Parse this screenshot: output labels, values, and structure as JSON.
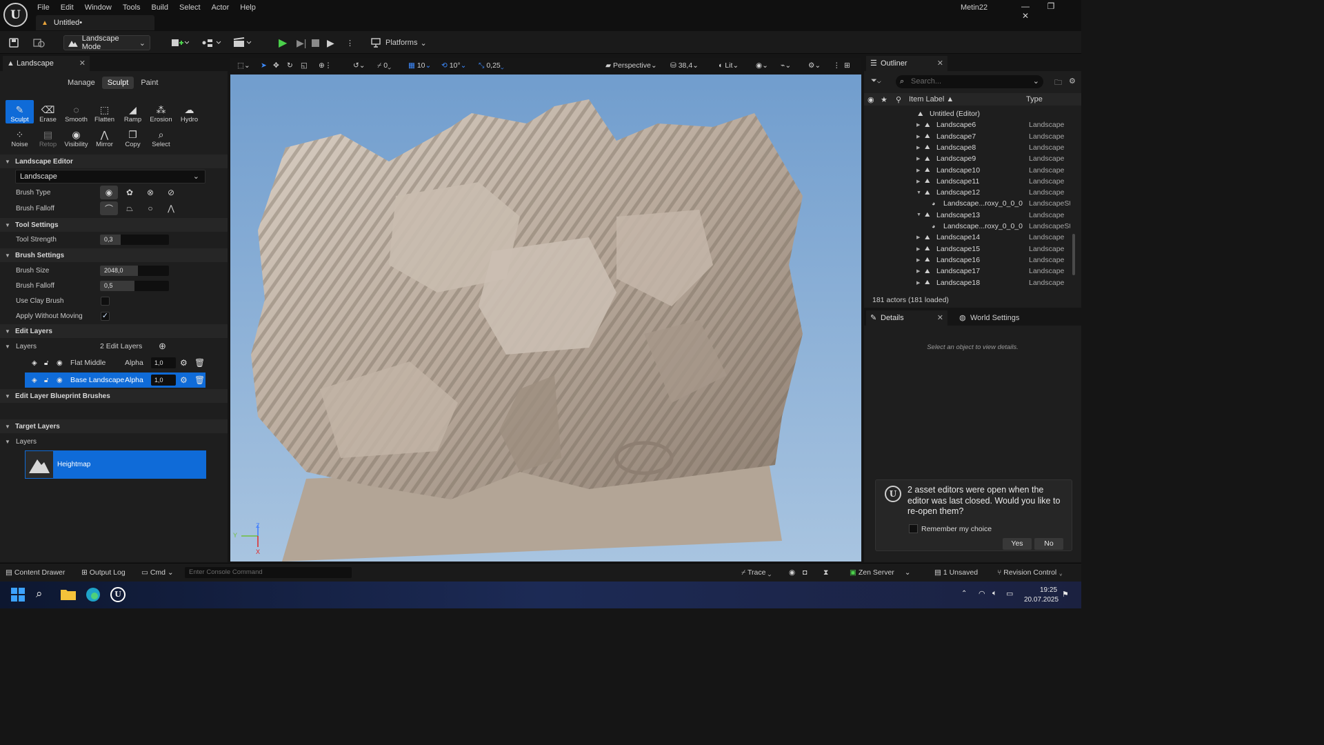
{
  "app": {
    "logo_text": "U",
    "menu": [
      "File",
      "Edit",
      "Window",
      "Tools",
      "Build",
      "Select",
      "Actor",
      "Help"
    ],
    "doc_tab": "Untitled•",
    "project_name": "Metin22",
    "window_controls": {
      "minimize": "—",
      "restore": "❐",
      "close": "✕"
    }
  },
  "toolbar": {
    "mode_label": "Landscape Mode",
    "platforms_label": "Platforms"
  },
  "landscape_panel": {
    "tab_title": "Landscape",
    "mode_tabs": [
      "Manage",
      "Sculpt",
      "Paint"
    ],
    "tools_row1": [
      {
        "label": "Sculpt",
        "icon": "brush-icon"
      },
      {
        "label": "Erase",
        "icon": "eraser-icon"
      },
      {
        "label": "Smooth",
        "icon": "smooth-icon"
      },
      {
        "label": "Flatten",
        "icon": "flatten-icon"
      },
      {
        "label": "Ramp",
        "icon": "ramp-icon"
      },
      {
        "label": "Erosion",
        "icon": "erosion-icon"
      },
      {
        "label": "Hydro",
        "icon": "hydro-icon"
      }
    ],
    "tools_row2": [
      {
        "label": "Noise",
        "icon": "noise-icon"
      },
      {
        "label": "Retop",
        "icon": "retop-icon"
      },
      {
        "label": "Visibility",
        "icon": "visibility-icon"
      },
      {
        "label": "Mirror",
        "icon": "mirror-icon"
      },
      {
        "label": "Copy",
        "icon": "copy-icon"
      },
      {
        "label": "Select",
        "icon": "select-icon"
      }
    ],
    "sections": {
      "landscape_editor": "Landscape Editor",
      "tool_settings": "Tool Settings",
      "brush_settings": "Brush Settings",
      "edit_layers": "Edit Layers",
      "edit_layer_bp": "Edit Layer Blueprint Brushes",
      "target_layers": "Target Layers"
    },
    "landscape_select": "Landscape",
    "brush_type_label": "Brush Type",
    "brush_falloff_label": "Brush Falloff",
    "tool_strength_label": "Tool Strength",
    "tool_strength_value": "0,3",
    "tool_strength_fraction": 0.3,
    "brush_size_label": "Brush Size",
    "brush_size_value": "2048,0",
    "brush_size_fraction": 0.55,
    "brush_falloff2_label": "Brush Falloff",
    "brush_falloff2_value": "0,5",
    "brush_falloff2_fraction": 0.5,
    "use_clay_label": "Use Clay Brush",
    "use_clay_checked": false,
    "apply_without_moving_label": "Apply Without Moving",
    "apply_without_moving_checked": true,
    "layers_label": "Layers",
    "edit_layers_count": "2 Edit Layers",
    "edit_layers_list": [
      {
        "name": "Flat Middle",
        "alpha_label": "Alpha",
        "alpha": "1,0",
        "selected": false
      },
      {
        "name": "Base Landscape",
        "alpha_label": "Alpha",
        "alpha": "1,0",
        "selected": true
      }
    ],
    "target_layers_label": "Layers",
    "heightmap_label": "Heightmap"
  },
  "viewport": {
    "rotate_snap": "0",
    "grid_snap": "10",
    "angle_snap": "10°",
    "scale_snap": "0,25",
    "view_mode_label": "Perspective",
    "camera_speed": "38,4",
    "lighting_label": "Lit",
    "axis": {
      "y": "Y",
      "z": "Z",
      "x": "X"
    }
  },
  "outliner": {
    "tab_title": "Outliner",
    "search_placeholder": "Search...",
    "col_label": "Item Label ▲",
    "col_type": "Type",
    "rows": [
      {
        "label": "Untitled (Editor)",
        "type": "",
        "indent": 0,
        "expand": ""
      },
      {
        "label": "Landscape6",
        "type": "Landscape",
        "indent": 1,
        "expand": "▶"
      },
      {
        "label": "Landscape7",
        "type": "Landscape",
        "indent": 1,
        "expand": "▶"
      },
      {
        "label": "Landscape8",
        "type": "Landscape",
        "indent": 1,
        "expand": "▶"
      },
      {
        "label": "Landscape9",
        "type": "Landscape",
        "indent": 1,
        "expand": "▶"
      },
      {
        "label": "Landscape10",
        "type": "Landscape",
        "indent": 1,
        "expand": "▶"
      },
      {
        "label": "Landscape11",
        "type": "Landscape",
        "indent": 1,
        "expand": "▶"
      },
      {
        "label": "Landscape12",
        "type": "Landscape",
        "indent": 1,
        "expand": "▼"
      },
      {
        "label": "Landscape...roxy_0_0_0",
        "type": "LandscapeSt",
        "indent": 2,
        "expand": ""
      },
      {
        "label": "Landscape13",
        "type": "Landscape",
        "indent": 1,
        "expand": "▼"
      },
      {
        "label": "Landscape...roxy_0_0_0",
        "type": "LandscapeSt",
        "indent": 2,
        "expand": ""
      },
      {
        "label": "Landscape14",
        "type": "Landscape",
        "indent": 1,
        "expand": "▶"
      },
      {
        "label": "Landscape15",
        "type": "Landscape",
        "indent": 1,
        "expand": "▶"
      },
      {
        "label": "Landscape16",
        "type": "Landscape",
        "indent": 1,
        "expand": "▶"
      },
      {
        "label": "Landscape17",
        "type": "Landscape",
        "indent": 1,
        "expand": "▶"
      },
      {
        "label": "Landscape18",
        "type": "Landscape",
        "indent": 1,
        "expand": "▶"
      }
    ],
    "actor_count": "181 actors (181 loaded)"
  },
  "details": {
    "tab_title": "Details",
    "world_settings_tab": "World Settings",
    "hint": "Select an object to view details."
  },
  "toast": {
    "message": "2 asset editors were open when the editor was last closed. Would you like to re-open them?",
    "remember_label": "Remember my choice",
    "yes_label": "Yes",
    "no_label": "No"
  },
  "statusbar": {
    "content_drawer": "Content Drawer",
    "output_log": "Output Log",
    "cmd": "Cmd",
    "console_placeholder": "Enter Console Command",
    "trace": "Trace",
    "zen_server": "Zen Server",
    "unsaved": "1 Unsaved",
    "revision_control": "Revision Control"
  },
  "taskbar": {
    "time": "19:25",
    "date": "20.07.2025"
  },
  "colors": {
    "accent": "#0f6bd8",
    "play_green": "#4bd04b",
    "warning_orange": "#e8a33a",
    "sky": "#7fa6d1"
  }
}
